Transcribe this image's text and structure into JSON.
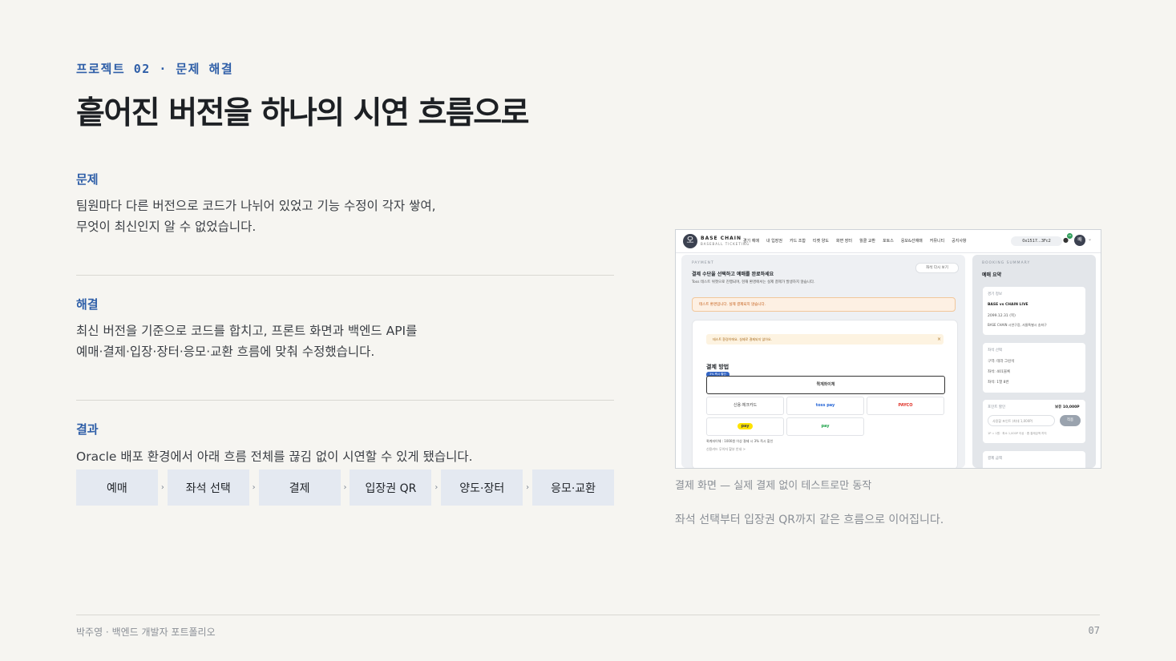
{
  "eyebrow": "프로젝트 02 · 문제 해결",
  "title": "흩어진 버전을 하나의 시연 흐름으로",
  "problem": {
    "heading": "문제",
    "line1": "팀원마다 다른 버전으로 코드가 나뉘어 있었고 기능 수정이 각자 쌓여,",
    "line2": "무엇이 최신인지 알 수 없었습니다."
  },
  "solution": {
    "heading": "해결",
    "line1": "최신 버전을 기준으로 코드를 합치고, 프론트 화면과 백엔드 API를",
    "line2": "예매·결제·입장·장터·응모·교환 흐름에 맞춰 수정했습니다."
  },
  "result": {
    "heading": "결과",
    "line1": "Oracle 배포 환경에서 아래 흐름 전체를 끊김 없이 시연할 수 있게 됐습니다."
  },
  "flow": {
    "steps": [
      "예매",
      "좌석 선택",
      "결제",
      "입장권 QR",
      "양도·장터",
      "응모·교환"
    ],
    "separator": "›"
  },
  "screenshot": {
    "logo_glyph": "오",
    "brand": "BASE CHAIN",
    "brand_sub": "BASEBALL TICKETING",
    "nav_items": [
      "경기 예매",
      "내 입장권",
      "카드 조합",
      "티켓 양도",
      "화면 장터",
      "월클 교환",
      "포토스",
      "응모&선예매",
      "커뮤니티",
      "공지사항"
    ],
    "wallet": "0x1517...3Fc2",
    "notif_count": "15",
    "avatar": "배",
    "payment_label": "PAYMENT",
    "payment_title": "결제 수단을 선택하고 예매를 완료하세요",
    "payment_desc": "Toss 테스트 위젯으로 진행되며, 현재 환경에서는 실제 결제가 발생하지 않습니다.",
    "back_btn": "좌석 다시 보기",
    "warn": "테스트 환경입니다. 실제 결제되지 않습니다.",
    "warn_inner": "테스트 환경이에요. 실제로 결제되지 않아요.",
    "close_glyph": "×",
    "method_title": "결제 방법",
    "recommend_tag": "3% 즉시 할인",
    "methods": [
      "퀵계좌이체",
      "신용·체크카드",
      "toss pay",
      "PAYCO",
      "pay",
      "pay"
    ],
    "method_note": "퀵계좌이체 : 1000원 이상 결제 시 3% 즉시 할인",
    "method_note2": "신용카드 무이자 할부 안내 >",
    "summary_label": "BOOKING SUMMARY",
    "summary_title": "예매 요약",
    "game_label": "경기 정보",
    "game_name": "BASE vs CHAIN LIVE",
    "game_date": "2099.12.31 (목)",
    "game_place": "BASE CHAIN 시연구장, 서울특별시 송파구",
    "seat_label": "좌석 선택",
    "seat_zone": "구역: 테라 그린석",
    "seat_no": "좌석: 401블록",
    "seat_cnt": "좌석: 1열 8번",
    "point_label": "포인트 할인",
    "point_value": "보유 10,000P",
    "point_placeholder": "사용할 포인트 (최대 1,000P)",
    "point_apply": "적용",
    "point_note": "1P = 1원 · 최소 1,000P 이상 · 좀 결제금액 까지",
    "pay_label": "결제 금액"
  },
  "caption": "결제 화면 — 실제 결제 없이 테스트로만 동작",
  "note": "좌석 선택부터 입장권 QR까지 같은 흐름으로 이어집니다.",
  "footer": {
    "left": "박주영 · 백엔드 개발자 포트폴리오",
    "page": "07"
  },
  "colors": {
    "accent": "#2f5fa8",
    "background": "#f6f5f1",
    "flow_step_bg": "#e4e9f1"
  }
}
